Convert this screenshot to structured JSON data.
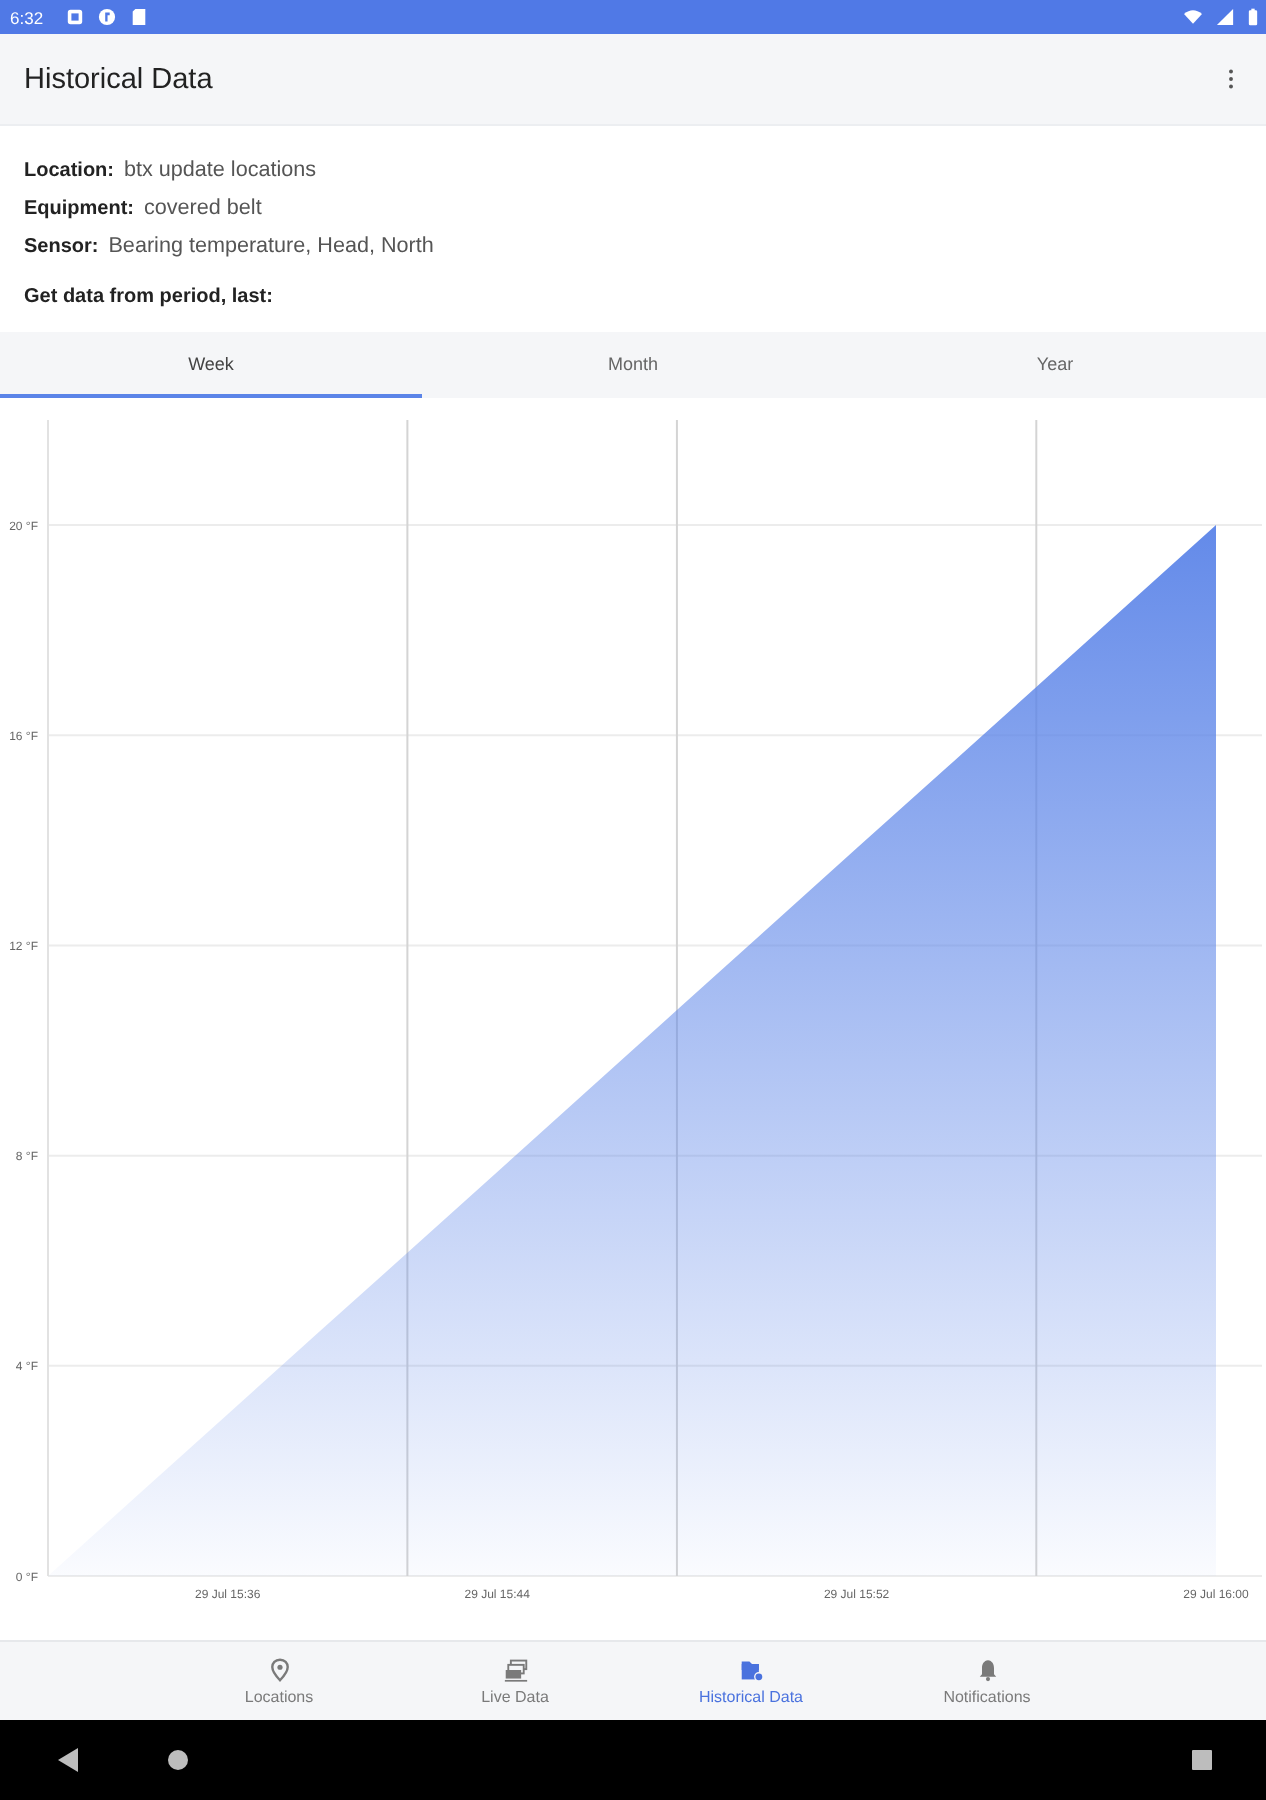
{
  "status_bar": {
    "time": "6:32"
  },
  "app_bar": {
    "title": "Historical Data"
  },
  "details": [
    {
      "label": "Location:",
      "value": "btx update locations"
    },
    {
      "label": "Equipment:",
      "value": "covered belt"
    },
    {
      "label": "Sensor:",
      "value": "Bearing temperature, Head, North"
    }
  ],
  "period_prompt": "Get data from period, last:",
  "tabs": [
    {
      "label": "Week",
      "selected": true
    },
    {
      "label": "Month",
      "selected": false
    },
    {
      "label": "Year",
      "selected": false
    }
  ],
  "chart": {
    "chart_data": {
      "type": "area",
      "grid": true,
      "categories": [
        null,
        null,
        "29 Jul 15:36",
        null,
        null,
        "29 Jul 15:44",
        null,
        null,
        null,
        "29 Jul 15:52",
        null,
        null,
        null,
        "29 Jul 16:00"
      ],
      "series": [
        {
          "color": "#5b84e8",
          "values": [
            0,
            1.54,
            3.08,
            4.62,
            6.15,
            7.69,
            9.23,
            10.77,
            12.31,
            13.85,
            15.38,
            16.92,
            18.46,
            20
          ]
        }
      ],
      "ylim": [
        0,
        22
      ],
      "yticks": [
        {
          "value": 0,
          "label": "0 °F"
        },
        {
          "value": 4,
          "label": "4 °F"
        },
        {
          "value": 8,
          "label": "8 °F"
        },
        {
          "value": 12,
          "label": "12 °F"
        },
        {
          "value": 16,
          "label": "16 °F"
        },
        {
          "value": 20,
          "label": "20 °F"
        }
      ]
    }
  },
  "bottom_nav": {
    "items": [
      {
        "label": "Locations",
        "selected": false
      },
      {
        "label": "Live Data",
        "selected": false
      },
      {
        "label": "Historical Data",
        "selected": true
      },
      {
        "label": "Notifications",
        "selected": false
      }
    ]
  }
}
